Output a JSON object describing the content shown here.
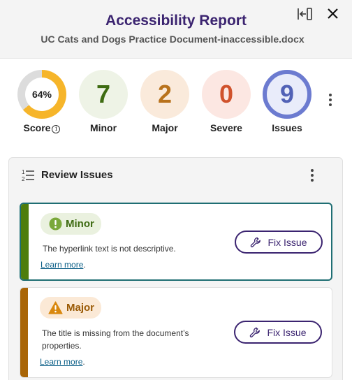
{
  "header": {
    "title": "Accessibility Report",
    "subtitle": "UC Cats and Dogs Practice Document-inaccessible.docx"
  },
  "summary": {
    "score": {
      "value": "64%",
      "percent": 64,
      "label": "Score",
      "ring_color": "#f6b52a",
      "track_color": "#dcdcdc"
    },
    "stats": [
      {
        "key": "minor",
        "value": "7",
        "label": "Minor",
        "bg": "#eef3e6",
        "color": "#3e6b12"
      },
      {
        "key": "major",
        "value": "2",
        "label": "Major",
        "bg": "#faeadb",
        "color": "#b8721c"
      },
      {
        "key": "severe",
        "value": "0",
        "label": "Severe",
        "bg": "#fce7e2",
        "color": "#d0522c"
      },
      {
        "key": "issues",
        "value": "9",
        "label": "Issues",
        "bg": "#e9ecfa",
        "color": "#5262b6"
      }
    ]
  },
  "review": {
    "title": "Review Issues",
    "issues": [
      {
        "severity": "Minor",
        "description_lines": [
          "The hyperlink text is not descriptive."
        ],
        "learn_more": "Learn more",
        "fix_label": "Fix Issue",
        "stripe_color": "#4e7d0c",
        "badge_bg": "#eaf1df",
        "badge_color": "#3e6b12",
        "icon_color": "#7aa83b",
        "border_color": "#1f6e73"
      },
      {
        "severity": "Major",
        "description_lines": [
          "The title is missing from the document’s",
          "properties."
        ],
        "learn_more": "Learn more",
        "fix_label": "Fix Issue",
        "stripe_color": "#a96506",
        "badge_bg": "#fbe9d6",
        "badge_color": "#9a5a05",
        "icon_color": "#d9880f",
        "border_color": "#e0e0e0"
      }
    ]
  },
  "colors": {
    "accent": "#3b2470",
    "link": "#0b5f87"
  }
}
